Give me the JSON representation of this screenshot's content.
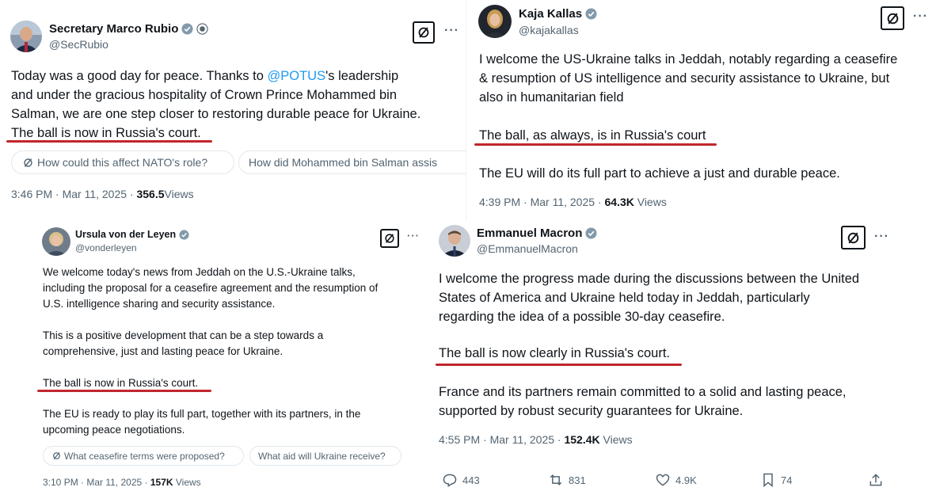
{
  "rubio": {
    "name": "Secretary Marco Rubio",
    "handle": "@SecRubio",
    "text_before": "Today was a good day for peace. Thanks to ",
    "mention": "@POTUS",
    "text_after": "'s leadership\nand under the gracious hospitality of Crown Prince Mohammed bin\nSalman, we are one step closer to restoring durable peace for Ukraine.\n",
    "highlight": "The ball is now in Russia's court.",
    "chips": [
      "How could this affect NATO's role?",
      "How did Mohammed bin Salman assis"
    ],
    "time": "3:46 PM · Mar 11, 2025 · ",
    "views_count": "356.5",
    "views_label": "Views"
  },
  "kallas": {
    "name": "Kaja Kallas",
    "handle": "@kajakallas",
    "text": "I welcome the US-Ukraine talks in Jeddah, notably regarding a ceasefire\n& resumption of US intelligence and security assistance to Ukraine, but\nalso in humanitarian field",
    "highlight": "The ball, as always, is in Russia's court",
    "text2": "The EU will do its full part to achieve a just and durable peace.",
    "time": "4:39 PM · Mar 11, 2025 · ",
    "views_count": "64.3K",
    "views_label": " Views"
  },
  "vdl": {
    "name": "Ursula von der Leyen",
    "handle": "@vonderleyen",
    "text": "We welcome today's news from Jeddah on the U.S.-Ukraine talks,\nincluding the proposal for a ceasefire agreement and the resumption of\nU.S. intelligence sharing and security assistance.",
    "text2": "This is a positive development that can be a step towards a\ncomprehensive, just and lasting peace for Ukraine.",
    "highlight": "The ball is now in Russia's court.",
    "text3": "The EU is ready to play its full part, together with its partners, in the\nupcoming peace negotiations.",
    "chips": [
      "What ceasefire terms were proposed?",
      "What aid will Ukraine receive?"
    ],
    "time": "3:10 PM · Mar 11, 2025 · ",
    "views_count": "157K",
    "views_label": " Views"
  },
  "macron": {
    "name": "Emmanuel Macron",
    "handle": "@EmmanuelMacron",
    "text": "I welcome the progress made during the discussions between the United\nStates of America and Ukraine held today in Jeddah, particularly\nregarding the idea of a possible 30-day ceasefire.",
    "highlight": "The ball is now clearly in Russia's court.",
    "text2": "France and its partners remain committed to a solid and lasting peace,\nsupported by robust security guarantees for Ukraine.",
    "time": "4:55 PM · Mar 11, 2025 · ",
    "views_count": "152.4K",
    "views_label": " Views",
    "replies": "443",
    "reposts": "831",
    "likes": "4.9K",
    "bookmarks": "74"
  },
  "colors": {
    "underline": "#c0262d",
    "verified": "#1d9bf0",
    "mention": "#1d9bf0"
  },
  "icons": [
    "verified-badge-icon",
    "grok-icon",
    "more-icon",
    "reply-icon",
    "repost-icon",
    "like-icon",
    "bookmark-icon",
    "share-icon"
  ]
}
